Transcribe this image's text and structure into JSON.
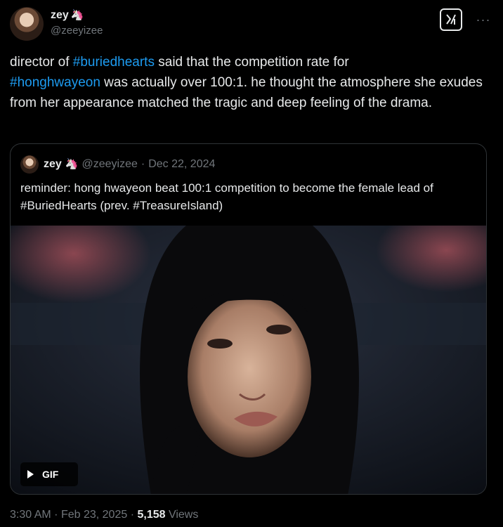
{
  "author": {
    "display_name": "zey",
    "emoji": "🦄",
    "handle": "@zeeyizee"
  },
  "header_actions": {
    "grok_icon": "grok-icon",
    "more_label": "···"
  },
  "tweet": {
    "segments": [
      {
        "text": "director of ",
        "type": "text"
      },
      {
        "text": "#buriedhearts",
        "type": "hashtag"
      },
      {
        "text": " said that the competition rate for ",
        "type": "text"
      },
      {
        "text": "#honghwayeon",
        "type": "hashtag"
      },
      {
        "text": " was actually over 100:1. he thought the atmosphere she exudes from her appearance matched the tragic and deep feeling of the drama.",
        "type": "text"
      }
    ]
  },
  "quote": {
    "display_name": "zey",
    "emoji": "🦄",
    "handle": "@zeeyizee",
    "separator": "·",
    "date": "Dec 22, 2024",
    "text": "reminder: hong hwayeon beat 100:1 competition to become the female lead of #BuriedHearts (prev. #TreasureIsland)",
    "media_type": "GIF"
  },
  "footer": {
    "time": "3:30 AM",
    "separator_1": "·",
    "date": "Feb 23, 2025",
    "separator_2": "·",
    "views_count": "5,158",
    "views_label": "Views"
  }
}
